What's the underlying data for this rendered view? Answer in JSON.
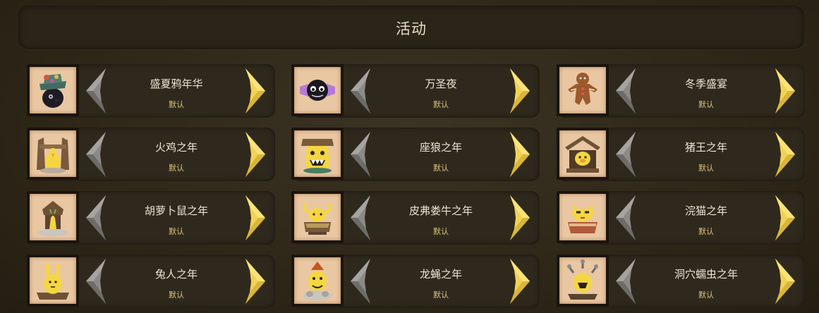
{
  "header": {
    "title": "活动"
  },
  "colors": {
    "accent_yellow": "#f2d254",
    "arrow_gray": "#8c8a86",
    "value_text": "#d6c37c",
    "icon_bg": "#e9c7a2"
  },
  "events": [
    {
      "name": "盛夏鸦年华",
      "value": "默认",
      "icon": "crow-hat-icon"
    },
    {
      "name": "万圣夜",
      "value": "默认",
      "icon": "spider-candy-icon"
    },
    {
      "name": "冬季盛宴",
      "value": "默认",
      "icon": "gingerbread-icon"
    },
    {
      "name": "火鸡之年",
      "value": "默认",
      "icon": "gobbler-shrine-icon"
    },
    {
      "name": "座狼之年",
      "value": "默认",
      "icon": "varg-shrine-icon"
    },
    {
      "name": "猪王之年",
      "value": "默认",
      "icon": "pig-shrine-icon"
    },
    {
      "name": "胡萝卜鼠之年",
      "value": "默认",
      "icon": "carrat-shrine-icon"
    },
    {
      "name": "皮弗娄牛之年",
      "value": "默认",
      "icon": "beefalo-shrine-icon"
    },
    {
      "name": "浣猫之年",
      "value": "默认",
      "icon": "catcoon-shrine-icon"
    },
    {
      "name": "兔人之年",
      "value": "默认",
      "icon": "bunnyman-shrine-icon"
    },
    {
      "name": "龙蝇之年",
      "value": "默认",
      "icon": "dragonfly-shrine-icon"
    },
    {
      "name": "洞穴蠕虫之年",
      "value": "默认",
      "icon": "depths-worm-shrine-icon"
    }
  ]
}
